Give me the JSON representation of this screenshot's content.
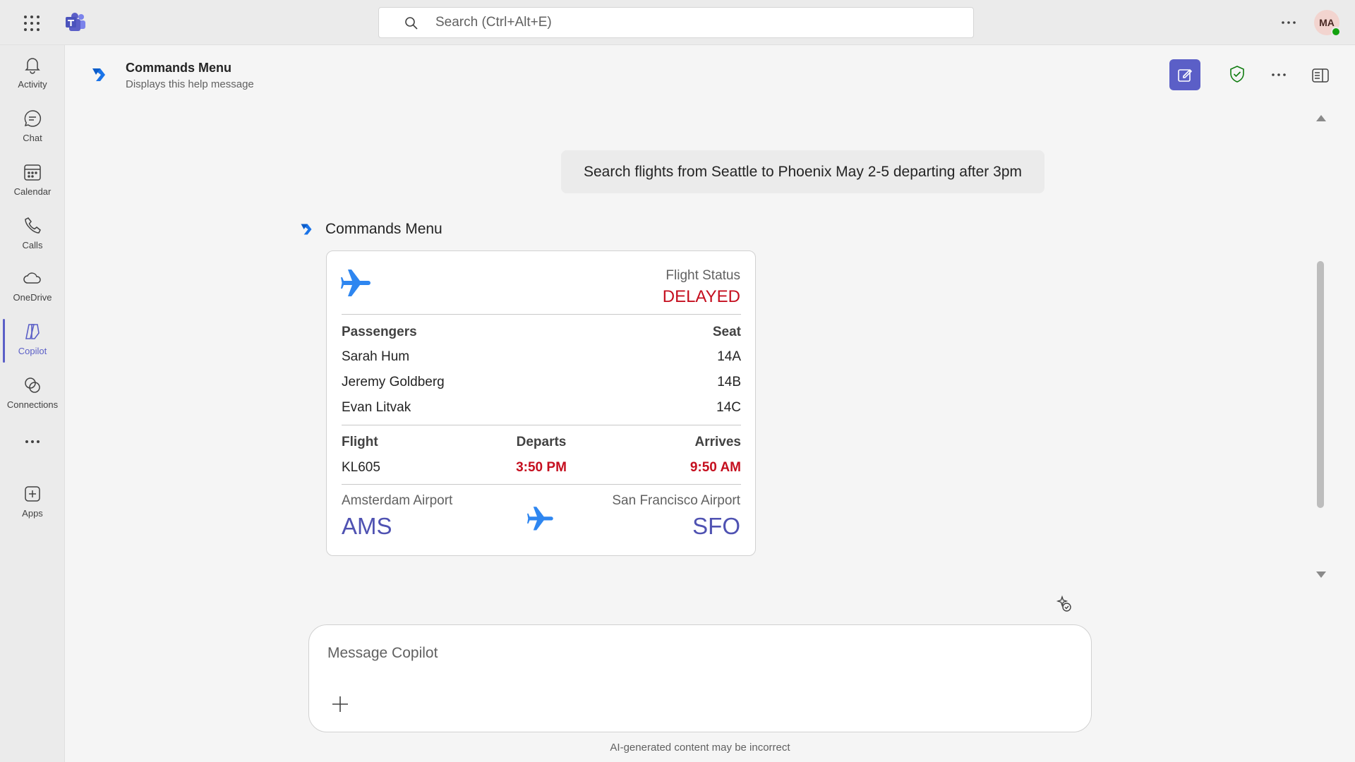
{
  "topbar": {
    "search_placeholder": "Search (Ctrl+Alt+E)",
    "avatar_initials": "MA",
    "icons": {
      "waffle": "app-launcher-icon",
      "logo": "teams-logo-icon",
      "search": "search-icon",
      "more": "more-icon"
    }
  },
  "rail": {
    "items": [
      {
        "label": "Activity",
        "icon": "bell-icon"
      },
      {
        "label": "Chat",
        "icon": "chat-icon"
      },
      {
        "label": "Calendar",
        "icon": "calendar-icon"
      },
      {
        "label": "Calls",
        "icon": "phone-icon"
      },
      {
        "label": "OneDrive",
        "icon": "cloud-icon"
      },
      {
        "label": "Copilot",
        "icon": "copilot-icon",
        "active": true
      },
      {
        "label": "Connections",
        "icon": "connections-icon"
      },
      {
        "label": "",
        "icon": "more-icon"
      },
      {
        "label": "Apps",
        "icon": "add-app-icon"
      }
    ]
  },
  "header": {
    "title": "Commands Menu",
    "subtitle": "Displays this help message"
  },
  "conversation": {
    "user_message": "Search flights from Seattle to Phoenix May 2-5 departing after 3pm",
    "bot_name": "Commands Menu"
  },
  "flight_card": {
    "status_label": "Flight Status",
    "status_value": "DELAYED",
    "passengers_header": "Passengers",
    "seat_header": "Seat",
    "passengers": [
      {
        "name": "Sarah Hum",
        "seat": "14A"
      },
      {
        "name": "Jeremy Goldberg",
        "seat": "14B"
      },
      {
        "name": "Evan Litvak",
        "seat": "14C"
      }
    ],
    "flight_header": "Flight",
    "departs_header": "Departs",
    "arrives_header": "Arrives",
    "flight_number": "KL605",
    "departs_time": "3:50 PM",
    "arrives_time": "9:50 AM",
    "origin_name": "Amsterdam Airport",
    "origin_code": "AMS",
    "destination_name": "San Francisco Airport",
    "destination_code": "SFO"
  },
  "composer": {
    "placeholder": "Message Copilot",
    "disclaimer": "AI-generated content may be incorrect"
  },
  "colors": {
    "accent": "#5b5fc7",
    "delayed": "#c50f1f",
    "airport_code": "#4f52b2",
    "plane": "#2e86f0"
  }
}
